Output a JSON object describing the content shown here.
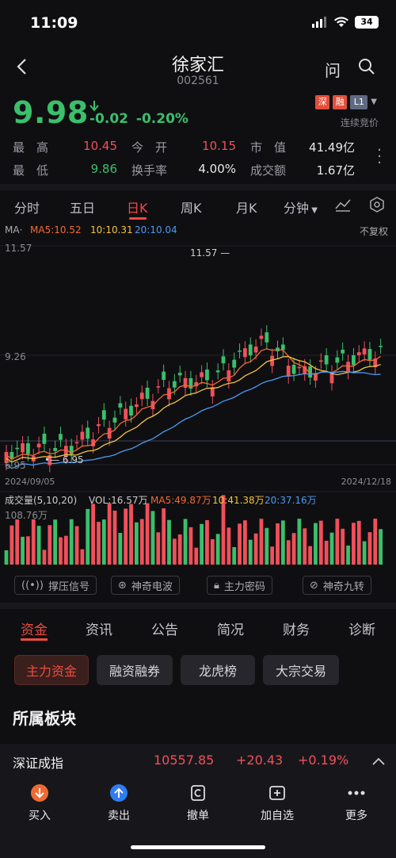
{
  "status_bar": {
    "time": "11:09",
    "battery": "34"
  },
  "header": {
    "name": "徐家汇",
    "code": "002561",
    "ask_icon": "问"
  },
  "quote": {
    "price": "9.98",
    "change": "-0.02",
    "change_pct": "-0.20%",
    "tags": [
      "深",
      "融",
      "L1"
    ],
    "session": "连续竞价",
    "stats": [
      {
        "label": "最　高",
        "value": "10.45",
        "color": "#f0505a"
      },
      {
        "label": "今　开",
        "value": "10.15",
        "color": "#f0505a"
      },
      {
        "label": "市　值",
        "value": "41.49亿",
        "color": "#e8e8ea"
      },
      {
        "label": "最　低",
        "value": "9.86",
        "color": "#3bbf6b"
      },
      {
        "label": "换手率",
        "value": "4.00%",
        "color": "#e8e8ea"
      },
      {
        "label": "成交额",
        "value": "1.67亿",
        "color": "#e8e8ea"
      }
    ]
  },
  "kline_tabs": [
    "分时",
    "五日",
    "日K",
    "周K",
    "月K",
    "分钟"
  ],
  "ma_legend": {
    "label": "MA·",
    "ma5": "MA5:10.52",
    "ma10": "10:10.31",
    "ma20": "20:10.04",
    "adjust": "不复权"
  },
  "chart_axis": {
    "y_top": "11.57",
    "y_mid": "9.26",
    "y_bottom": "6.95",
    "high_mark": "11.57",
    "low_mark": "6.95",
    "date_start": "2024/09/05",
    "date_end": "2024/12/18"
  },
  "volume_legend": {
    "title": "成交量(5,10,20)",
    "vol": "VOL:16.57万",
    "ma5": "MA5:49.87万",
    "ma10": "10:41.38万",
    "ma20": "20:37.16万",
    "max": "108.76万"
  },
  "signal_buttons": [
    "撑压信号",
    "神奇电波",
    "主力密码",
    "神奇九转"
  ],
  "section_tabs": [
    "资金",
    "资讯",
    "公告",
    "简况",
    "财务",
    "诊断"
  ],
  "fund_chips": [
    "主力资金",
    "融资融券",
    "龙虎榜",
    "大宗交易"
  ],
  "section_title": "所属板块",
  "index_bar": {
    "name": "深证成指",
    "value": "10557.85",
    "change": "+20.43",
    "pct": "+0.19%"
  },
  "bottom_nav": [
    "买入",
    "卖出",
    "撤单",
    "加自选",
    "更多"
  ],
  "colors": {
    "up": "#f0505a",
    "down": "#3bbf6b",
    "accent": "#f04b3e",
    "ma5": "#f06a35",
    "ma10": "#f5c33b",
    "ma20": "#4a9af0"
  }
}
